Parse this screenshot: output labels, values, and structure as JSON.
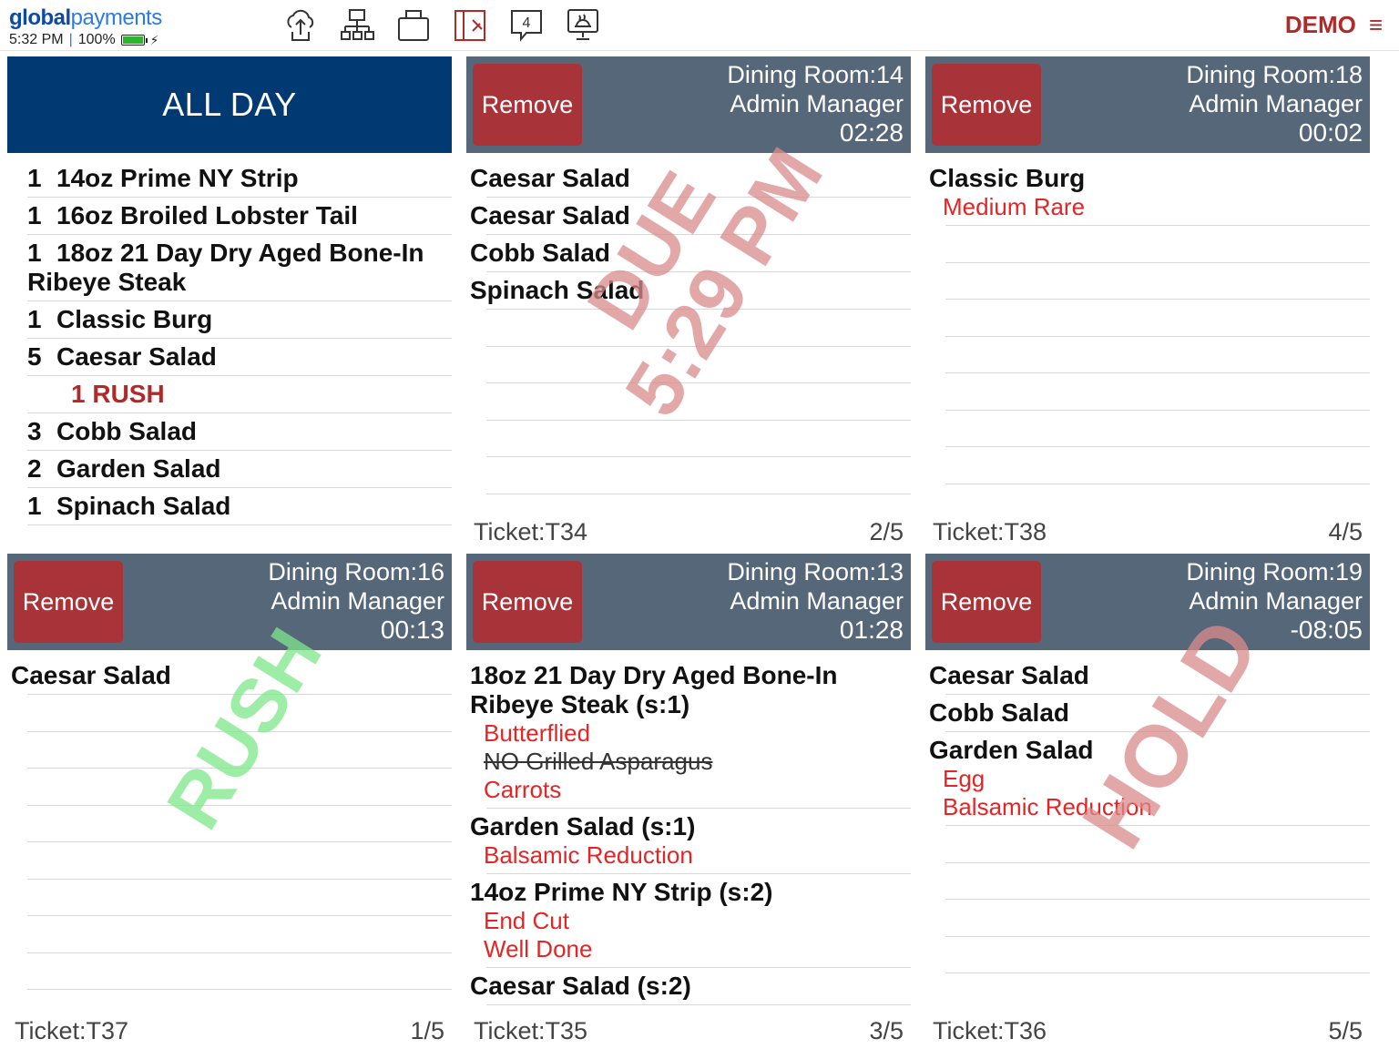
{
  "topbar": {
    "logo_bold": "global",
    "logo_light": "payments",
    "time": "5:32 PM",
    "battery_text": "100%",
    "battery_level": 1.0,
    "icons": [
      "cloud-sync-icon",
      "network-icon",
      "printer-icon",
      "kitchen-display-icon",
      "message-count-icon",
      "dish-monitor-icon"
    ],
    "message_count": "4",
    "mode": "DEMO"
  },
  "allday": {
    "title": "ALL DAY",
    "items": [
      {
        "qty": "1",
        "name": "14oz Prime NY Strip"
      },
      {
        "qty": "1",
        "name": "16oz Broiled Lobster Tail"
      },
      {
        "qty": "1",
        "name": "18oz 21 Day Dry Aged Bone-In Ribeye Steak"
      },
      {
        "qty": "1",
        "name": "Classic Burg"
      },
      {
        "qty": "5",
        "name": "Caesar Salad"
      },
      {
        "qty": "",
        "name": "1 RUSH",
        "rush": true
      },
      {
        "qty": "3",
        "name": "Cobb Salad"
      },
      {
        "qty": "2",
        "name": "Garden Salad"
      },
      {
        "qty": "1",
        "name": "Spinach Salad"
      }
    ]
  },
  "tickets": [
    {
      "remove_label": "Remove",
      "room": "Dining Room:14",
      "server": "Admin Manager",
      "time": "02:28",
      "ticket": "Ticket:T34",
      "page": "2/5",
      "stamp": [
        "DUE",
        "5:29 PM"
      ],
      "items": [
        {
          "name": "Caesar Salad",
          "mods": []
        },
        {
          "name": "Caesar Salad",
          "mods": []
        },
        {
          "name": "Cobb Salad",
          "mods": []
        },
        {
          "name": "Spinach Salad",
          "mods": []
        }
      ]
    },
    {
      "remove_label": "Remove",
      "room": "Dining Room:18",
      "server": "Admin Manager",
      "time": "00:02",
      "ticket": "Ticket:T38",
      "page": "4/5",
      "stamp": [],
      "items": [
        {
          "name": "Classic Burg",
          "mods": [
            {
              "text": "Medium Rare"
            }
          ]
        }
      ]
    },
    {
      "remove_label": "Remove",
      "room": "Dining Room:16",
      "server": "Admin Manager",
      "time": "00:13",
      "ticket": "Ticket:T37",
      "page": "1/5",
      "stamp": [
        "RUSH"
      ],
      "items": [
        {
          "name": "Caesar Salad",
          "mods": []
        }
      ]
    },
    {
      "remove_label": "Remove",
      "room": "Dining Room:13",
      "server": "Admin Manager",
      "time": "01:28",
      "ticket": "Ticket:T35",
      "page": "3/5",
      "stamp": [],
      "items": [
        {
          "name": "18oz 21 Day Dry Aged Bone-In Ribeye Steak (s:1)",
          "mods": [
            {
              "text": "Butterflied"
            },
            {
              "text": "NO Grilled Asparagus",
              "strike": true
            },
            {
              "text": "Carrots"
            }
          ]
        },
        {
          "name": "Garden Salad (s:1)",
          "mods": [
            {
              "text": "Balsamic Reduction"
            }
          ]
        },
        {
          "name": "14oz Prime NY Strip (s:2)",
          "mods": [
            {
              "text": "End Cut"
            },
            {
              "text": "Well Done"
            }
          ]
        },
        {
          "name": "Caesar Salad (s:2)",
          "mods": []
        }
      ]
    },
    {
      "remove_label": "Remove",
      "room": "Dining Room:19",
      "server": "Admin Manager",
      "time": "-08:05",
      "ticket": "Ticket:T36",
      "page": "5/5",
      "stamp": [
        "HOLD"
      ],
      "items": [
        {
          "name": "Caesar Salad",
          "mods": []
        },
        {
          "name": "Cobb Salad",
          "mods": []
        },
        {
          "name": "Garden Salad",
          "mods": [
            {
              "text": "Egg"
            },
            {
              "text": "Balsamic Reduction"
            }
          ]
        }
      ]
    }
  ],
  "colors": {
    "header": "#56677a",
    "allday_header": "#013a73",
    "remove": "#a8343a",
    "modifier": "#e52525",
    "due_stamp": "#d98b8b",
    "rush_stamp": "#7ee88a",
    "hold_stamp": "#d98b8b"
  }
}
